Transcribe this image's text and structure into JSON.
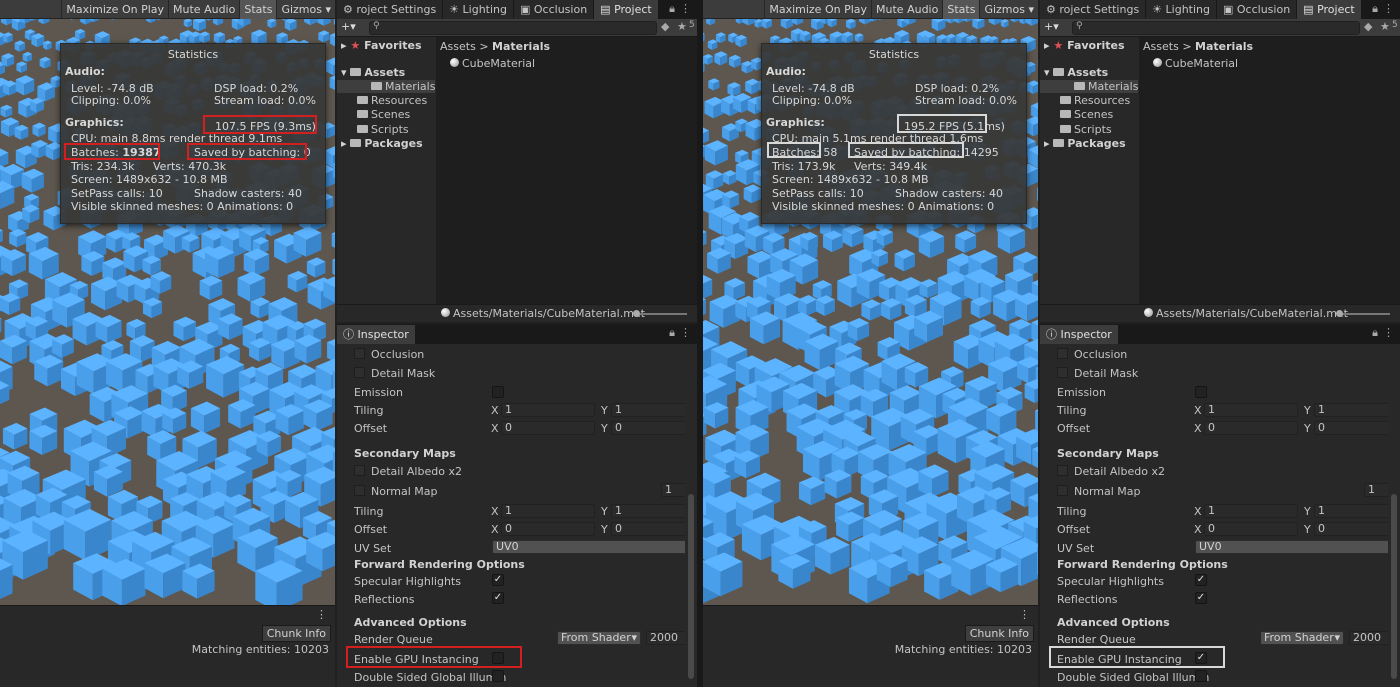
{
  "left": {
    "toolbar": {
      "maximize": "Maximize On Play",
      "mute": "Mute Audio",
      "stats": "Stats",
      "gizmos": "Gizmos"
    },
    "stats": {
      "title": "Statistics",
      "audio": "Audio:",
      "level": "Level: -74.8 dB",
      "clipping": "Clipping: 0.0%",
      "dsp": "DSP load: 0.2%",
      "stream": "Stream load: 0.0%",
      "graphics": "Graphics:",
      "fps": "107.5 FPS (9.3ms)",
      "cpu": "CPU: main 8.8ms  render thread 9.1ms",
      "batches_label": "Batches:",
      "batches_value": "19387",
      "saved": "Saved by batching: 0",
      "tris": "Tris: 234.3k",
      "verts": "Verts: 470.3k",
      "screen": "Screen: 1489x632 - 10.8 MB",
      "setpass": "SetPass calls: 10",
      "shadow": "Shadow casters: 40",
      "skinned": "Visible skinned meshes: 0  Animations: 0"
    },
    "chunk": "Chunk Info",
    "matching": "Matching entities: 10203"
  },
  "right": {
    "toolbar": {
      "maximize": "Maximize On Play",
      "mute": "Mute Audio",
      "stats": "Stats",
      "gizmos": "Gizmos"
    },
    "stats": {
      "title": "Statistics",
      "audio": "Audio:",
      "level": "Level: -74.8 dB",
      "clipping": "Clipping: 0.0%",
      "dsp": "DSP load: 0.2%",
      "stream": "Stream load: 0.0%",
      "graphics": "Graphics:",
      "fps": "195.2 FPS (5.1ms)",
      "cpu": "CPU: main 5.1ms  render thread 1.6ms",
      "batches_label": "Batches:",
      "batches_value": "58",
      "saved": "Saved by batching: 14295",
      "tris": "Tris: 173.9k",
      "verts": "Verts: 349.4k",
      "screen": "Screen: 1489x632 - 10.8 MB",
      "setpass": "SetPass calls: 10",
      "shadow": "Shadow casters: 40",
      "skinned": "Visible skinned meshes: 0  Animations: 0"
    },
    "chunk": "Chunk Info",
    "matching": "Matching entities: 10203"
  },
  "project": {
    "tabs": [
      "roject Settings",
      "Lighting",
      "Occlusion",
      "Project"
    ],
    "hidden_count": "5",
    "favorites": "Favorites",
    "assets": "Assets",
    "folders": [
      "Materials",
      "Resources",
      "Scenes",
      "Scripts"
    ],
    "packages": "Packages",
    "breadcrumb_root": "Assets",
    "breadcrumb_sep": ">",
    "breadcrumb_leaf": "Materials",
    "file": "CubeMaterial",
    "path": "Assets/Materials/CubeMaterial.mat"
  },
  "inspector": {
    "tab": "Inspector",
    "occlusion": "Occlusion",
    "detail_mask": "Detail Mask",
    "emission": "Emission",
    "tiling": "Tiling",
    "offset": "Offset",
    "x": "X",
    "y": "Y",
    "one": "1",
    "zero": "0",
    "secondary_maps": "Secondary Maps",
    "detail_albedo": "Detail Albedo x2",
    "normal_map": "Normal Map",
    "uv_set": "UV Set",
    "uv_value": "UV0",
    "forward": "Forward Rendering Options",
    "specular": "Specular Highlights",
    "reflections": "Reflections",
    "advanced": "Advanced Options",
    "render_queue": "Render Queue",
    "queue_mode": "From Shader",
    "queue_value": "2000",
    "gpu_instancing": "Enable GPU Instancing",
    "double_sided": "Double Sided Global Illumin",
    "checkmark": "✓"
  },
  "colors": {
    "cube_blue": "#4a9fea",
    "ground": "#5d574f",
    "highlight_red": "#d21f1f",
    "highlight_white": "#d8d8d8"
  }
}
